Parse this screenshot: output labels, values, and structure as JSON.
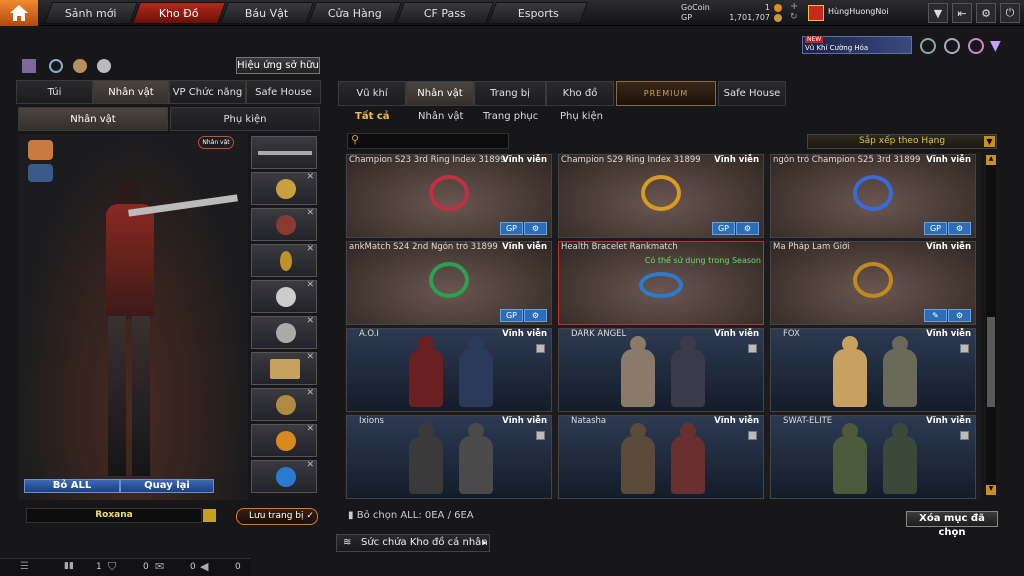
{
  "nav": {
    "items": [
      "Sảnh mới",
      "Kho Đồ",
      "Báu Vật",
      "Cửa Hàng",
      "CF Pass",
      "Esports"
    ]
  },
  "currency": {
    "gocoin_label": "GoCoin",
    "gocoin_value": "1",
    "gp_label": "GP",
    "gp_value": "1,701,707"
  },
  "user": {
    "name": "HùngHuongNoi"
  },
  "promo": {
    "badge": "NEW",
    "text": "Vũ Khí Cường Hóa"
  },
  "left": {
    "effects_button": "Hiệu ứng sở hữu",
    "tabs": [
      "Túi",
      "Nhân vật",
      "VP Chức năng",
      "Safe House"
    ],
    "subtabs": [
      "Nhân vật",
      "Phụ kiện"
    ],
    "char_badge": "Nhân vật",
    "remove_all": "Bỏ ALL",
    "back": "Quay lại",
    "char_name": "Roxana",
    "save_outfit": "Lưu trang bị"
  },
  "right": {
    "tabs": [
      "Vũ khí",
      "Nhân vật",
      "Trang bị",
      "Kho đồ",
      "PREMIUM",
      "Safe House"
    ],
    "subtabs": [
      "Tất cả",
      "Nhân vật",
      "Trang phục",
      "Phụ kiện"
    ],
    "sort_label": "Sắp xếp theo Hạng",
    "items": [
      {
        "name": "Champion S23 3rd Ring Index 31899",
        "duration": "Vĩnh viễn",
        "color": "#c03040"
      },
      {
        "name": "Champion S29 Ring Index 31899",
        "duration": "Vĩnh viễn",
        "color": "#d89a20"
      },
      {
        "name": "ngón trỏ Champion S25 3rd 31899",
        "duration": "Vĩnh viễn",
        "color": "#3a6ad8"
      },
      {
        "name": "ankMatch S24 2nd Ngón trỏ 31899",
        "duration": "Vĩnh viễn",
        "color": "#2aa050"
      },
      {
        "name": "Health Bracelet Rankmatch",
        "duration": "",
        "tooltip": "Có thể sử dụng trong Season",
        "color": "#2a7ad0"
      },
      {
        "name": "Ma Pháp Lam Giới",
        "duration": "Vĩnh viễn",
        "color": "#c08a20"
      }
    ],
    "characters": [
      {
        "name": "A.O.I",
        "duration": "Vĩnh viễn"
      },
      {
        "name": "DARK ANGEL",
        "duration": "Vĩnh viễn"
      },
      {
        "name": "FOX",
        "duration": "Vĩnh viễn"
      },
      {
        "name": "Ixions",
        "duration": "Vĩnh viễn"
      },
      {
        "name": "Natasha",
        "duration": "Vĩnh viễn"
      },
      {
        "name": "SWAT-ELITE",
        "duration": "Vĩnh viễn"
      }
    ],
    "deselect": "Bỏ chọn ALL: 0EA / 6EA",
    "delete_selected": "Xóa mục đã chọn",
    "capacity": "Sức chứa Kho đồ cá nhân"
  },
  "bottom": {
    "count1": "1",
    "count2": "0",
    "count3": "0",
    "count4": "0"
  }
}
